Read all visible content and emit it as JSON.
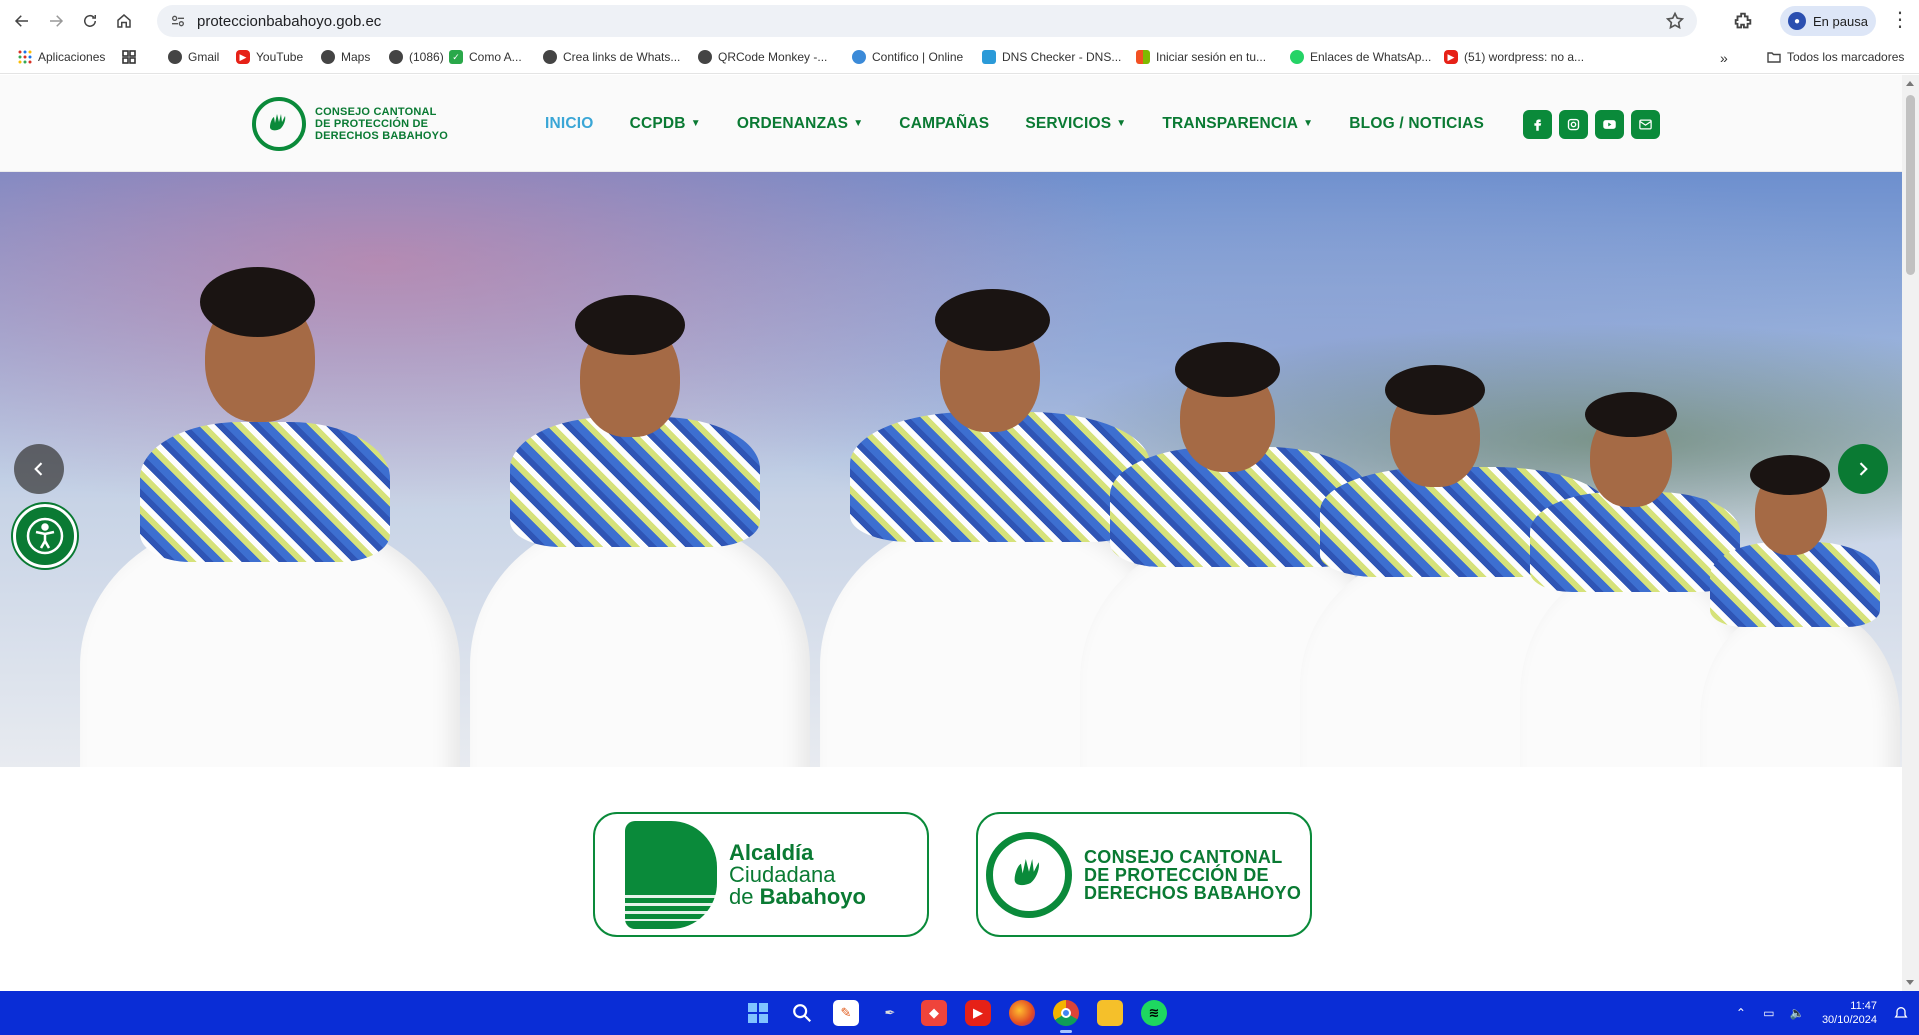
{
  "browser": {
    "url": "proteccionbabahoyo.gob.ec",
    "profile_label": "En pausa",
    "bookmarks": [
      {
        "label": "Aplicaciones",
        "icon": "apps-grid-icon"
      },
      {
        "label": "",
        "icon": "grid-icon"
      },
      {
        "label": "Gmail",
        "icon": "globe-icon"
      },
      {
        "label": "YouTube",
        "icon": "youtube-icon"
      },
      {
        "label": "Maps",
        "icon": "globe-icon"
      },
      {
        "label": "(1086)",
        "icon": "globe-icon"
      },
      {
        "label": "Como A...",
        "icon": "check-icon"
      },
      {
        "label": "Crea links de Whats...",
        "icon": "globe-icon"
      },
      {
        "label": "QRCode Monkey -...",
        "icon": "globe-icon"
      },
      {
        "label": "Contifico | Online",
        "icon": "contifico-icon"
      },
      {
        "label": "DNS Checker - DNS...",
        "icon": "shield-icon"
      },
      {
        "label": "Iniciar sesión en tu...",
        "icon": "microsoft-icon"
      },
      {
        "label": "Enlaces de WhatsAp...",
        "icon": "whatsapp-icon"
      },
      {
        "label": "(51) wordpress: no a...",
        "icon": "youtube-icon"
      }
    ],
    "all_bookmarks": "Todos los marcadores"
  },
  "site": {
    "logo_text": [
      "CONSEJO CANTONAL",
      "DE PROTECCIÓN DE",
      "DERECHOS BABAHOYO"
    ],
    "nav": [
      {
        "label": "INICIO",
        "active": true,
        "dropdown": false
      },
      {
        "label": "CCPDB",
        "active": false,
        "dropdown": true
      },
      {
        "label": "ORDENANZAS",
        "active": false,
        "dropdown": true
      },
      {
        "label": "CAMPAÑAS",
        "active": false,
        "dropdown": false
      },
      {
        "label": "SERVICIOS",
        "active": false,
        "dropdown": true
      },
      {
        "label": "TRANSPARENCIA",
        "active": false,
        "dropdown": true
      },
      {
        "label": "BLOG / NOTICIAS",
        "active": false,
        "dropdown": false
      }
    ],
    "socials": [
      "facebook-icon",
      "instagram-icon",
      "youtube-icon",
      "email-icon"
    ],
    "cards": {
      "alcaldia": [
        "Alcaldía",
        "Ciudadana",
        "de",
        "Babahoyo"
      ],
      "consejo": [
        "CONSEJO CANTONAL",
        "DE PROTECCIÓN DE",
        "DERECHOS BABAHOYO"
      ]
    },
    "brand_color": "#0a8a3a",
    "active_color": "#3aa6d6"
  },
  "taskbar": {
    "time": "11:47",
    "date": "30/10/2024",
    "apps": [
      "start-icon",
      "search-icon",
      "document-icon",
      "pen-icon",
      "anydesk-icon",
      "youtube-icon",
      "firefox-icon",
      "chrome-icon",
      "files-icon",
      "spotify-icon"
    ]
  }
}
